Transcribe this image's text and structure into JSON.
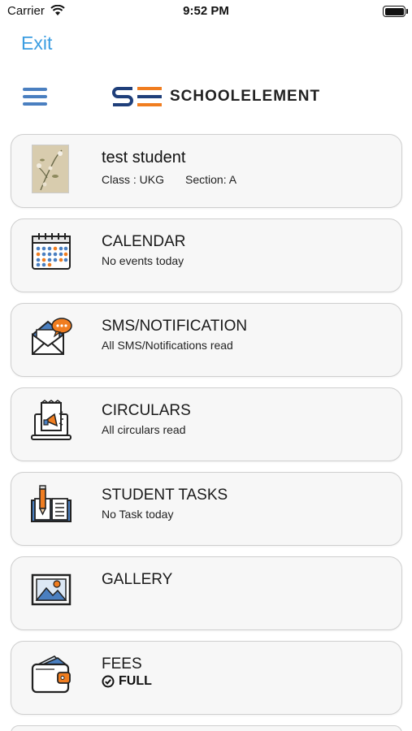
{
  "status_bar": {
    "carrier": "Carrier",
    "time": "9:52 PM"
  },
  "nav": {
    "exit_label": "Exit"
  },
  "brand": {
    "name": "SCHOOLELEMENT"
  },
  "student": {
    "name": "test student",
    "class_text": "Class : UKG",
    "section_text": "Section: A"
  },
  "cards": [
    {
      "title": "CALENDAR",
      "subtitle": "No events today",
      "icon": "calendar-icon"
    },
    {
      "title": "SMS/NOTIFICATION",
      "subtitle": "All SMS/Notifications read",
      "icon": "notification-envelope-icon"
    },
    {
      "title": "CIRCULARS",
      "subtitle": "All circulars read",
      "icon": "circulars-icon"
    },
    {
      "title": "STUDENT TASKS",
      "subtitle": "No Task today",
      "icon": "tasks-book-icon"
    },
    {
      "title": "GALLERY",
      "subtitle": "",
      "icon": "gallery-picture-icon"
    }
  ],
  "fees": {
    "title": "FEES",
    "status": "FULL",
    "icon": "wallet-icon"
  },
  "colors": {
    "accent": "#3b9de1",
    "brand_blue": "#1f3f7a",
    "brand_orange": "#f07d20",
    "card_bg": "#f7f7f7"
  }
}
